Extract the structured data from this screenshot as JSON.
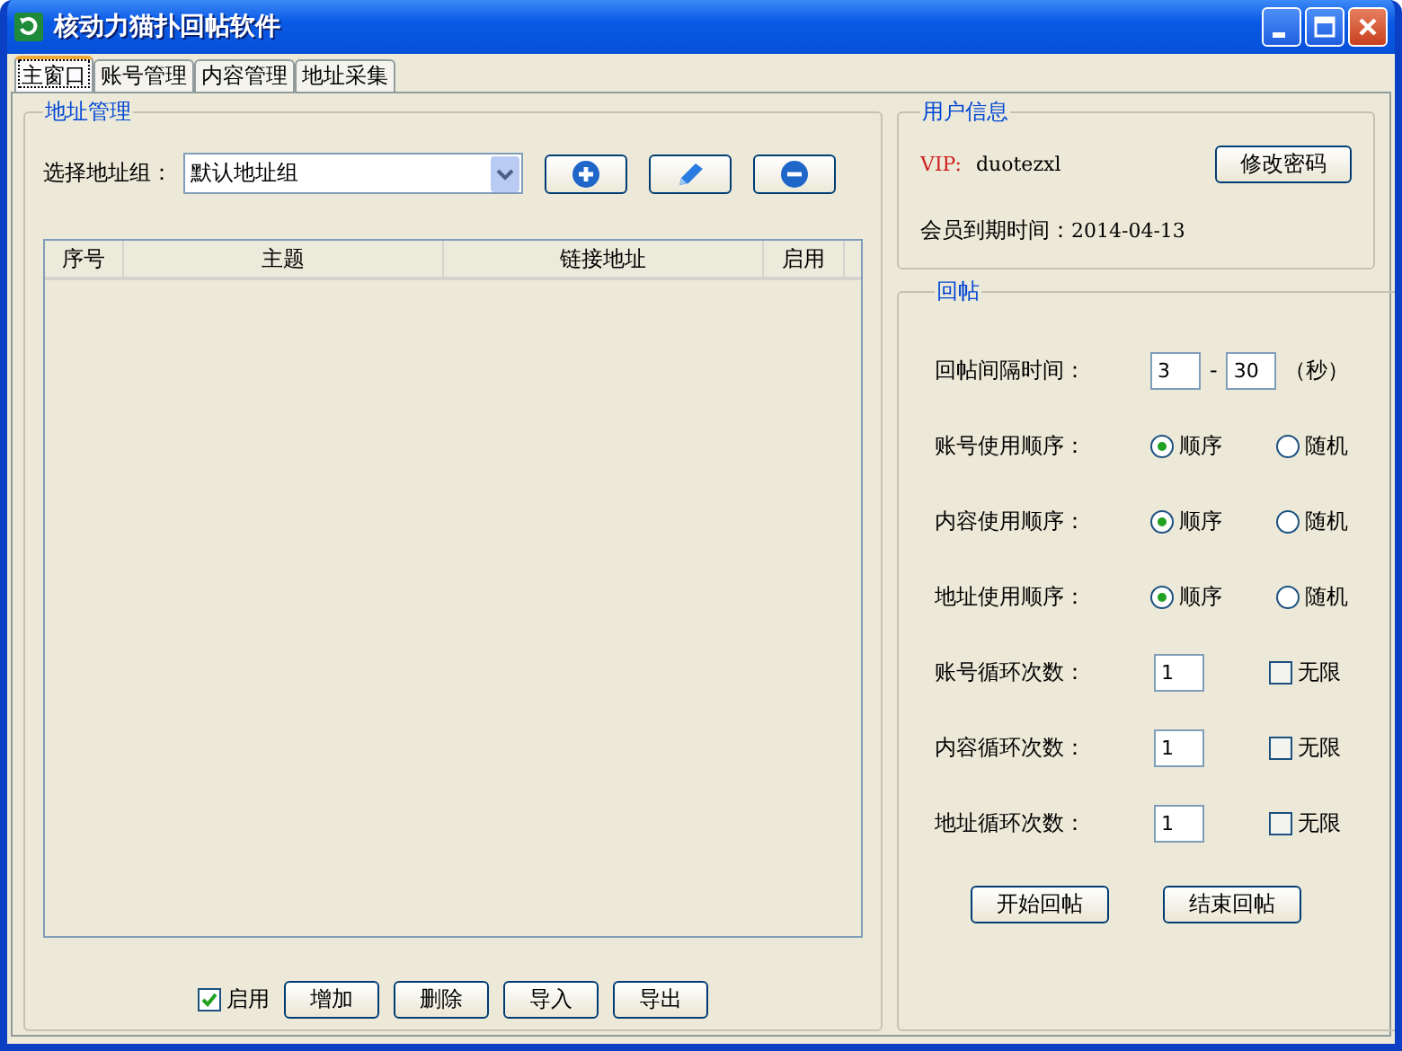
{
  "window": {
    "title": "核动力猫扑回帖软件"
  },
  "tabs": [
    {
      "label": "主窗口",
      "selected": true
    },
    {
      "label": "账号管理",
      "selected": false
    },
    {
      "label": "内容管理",
      "selected": false
    },
    {
      "label": "地址采集",
      "selected": false
    }
  ],
  "address_panel": {
    "title": "地址管理",
    "group_label": "选择地址组：",
    "group_value": "默认地址组",
    "table": {
      "columns": [
        "序号",
        "主题",
        "链接地址",
        "启用"
      ]
    },
    "enable": {
      "label": "启用",
      "checked": true
    },
    "buttons": [
      "增加",
      "删除",
      "导入",
      "导出"
    ]
  },
  "user_info": {
    "title": "用户信息",
    "vip_label": "VIP:",
    "username": "duotezxl",
    "change_password": "修改密码",
    "expiry_label": "会员到期时间：",
    "expiry": "2014-04-13"
  },
  "reply": {
    "title": "回帖",
    "interval_label": "回帖间隔时间：",
    "interval_min": "3",
    "interval_sep": "-",
    "interval_max": "30",
    "interval_unit": "（秒）",
    "orders": [
      {
        "label": "账号使用顺序：",
        "options": [
          {
            "label": "顺序",
            "selected": true
          },
          {
            "label": "随机",
            "selected": false
          }
        ]
      },
      {
        "label": "内容使用顺序：",
        "options": [
          {
            "label": "顺序",
            "selected": true
          },
          {
            "label": "随机",
            "selected": false
          }
        ]
      },
      {
        "label": "地址使用顺序：",
        "options": [
          {
            "label": "顺序",
            "selected": true
          },
          {
            "label": "随机",
            "selected": false
          }
        ]
      }
    ],
    "loops": [
      {
        "label": "账号循环次数：",
        "value": "1",
        "unlimited_label": "无限",
        "unlimited": false
      },
      {
        "label": "内容循环次数：",
        "value": "1",
        "unlimited_label": "无限",
        "unlimited": false
      },
      {
        "label": "地址循环次数：",
        "value": "1",
        "unlimited_label": "无限",
        "unlimited": false
      }
    ],
    "buttons": [
      "开始回帖",
      "结束回帖"
    ]
  }
}
